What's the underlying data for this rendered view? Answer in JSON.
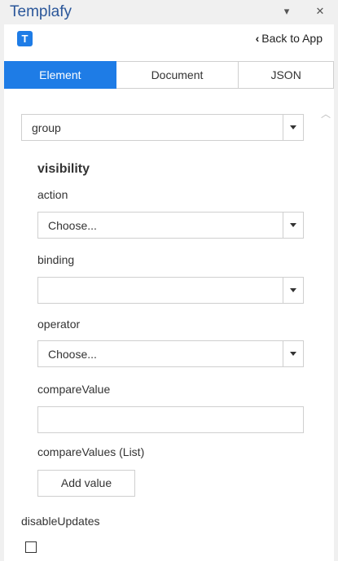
{
  "window": {
    "title": "Templafy",
    "menu_icon": "chevron-down-icon",
    "close_icon": "close-icon"
  },
  "appbar": {
    "logo_letter": "T",
    "back_label": "Back to App"
  },
  "tabs": [
    {
      "label": "Element",
      "active": true
    },
    {
      "label": "Document",
      "active": false
    },
    {
      "label": "JSON",
      "active": false
    }
  ],
  "form": {
    "type_select": {
      "value": "group"
    },
    "visibility": {
      "heading": "visibility",
      "action": {
        "label": "action",
        "value": "Choose..."
      },
      "binding": {
        "label": "binding",
        "value": ""
      },
      "operator": {
        "label": "operator",
        "value": "Choose..."
      },
      "compare_value": {
        "label": "compareValue",
        "value": ""
      },
      "compare_values": {
        "label": "compareValues (List)",
        "add_button": "Add value"
      }
    },
    "disable_updates": {
      "label": "disableUpdates",
      "checked": false
    }
  },
  "colors": {
    "accent": "#1e7ce6",
    "title_text": "#2b579a"
  }
}
